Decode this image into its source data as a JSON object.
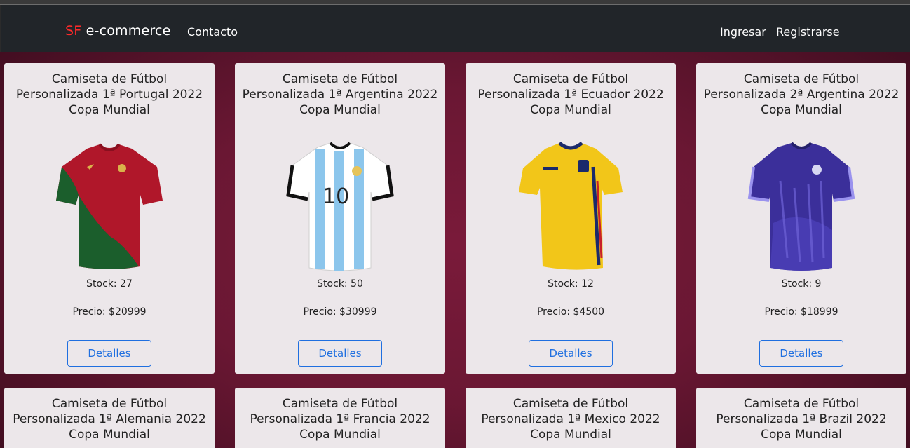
{
  "navbar": {
    "brand_prefix": "SF",
    "brand_suffix": " e-commerce",
    "contact": "Contacto",
    "login": "Ingresar",
    "register": "Registrarse"
  },
  "colors": {
    "brand_accent": "#ff2a2a",
    "button_blue": "#1f6fe0",
    "background": "#6a1733"
  },
  "products": [
    {
      "title_lines": [
        "Camiseta de Fútbol",
        "Personalizada 1ª Portugal 2022",
        "Copa Mundial"
      ],
      "stock": "Stock: 27",
      "price": "Precio: $20999",
      "button": "Detalles",
      "image": "portugal-jersey-icon"
    },
    {
      "title_lines": [
        "Camiseta de Fútbol",
        "Personalizada 1ª Argentina 2022",
        "Copa Mundial"
      ],
      "stock": "Stock: 50",
      "price": "Precio: $30999",
      "button": "Detalles",
      "image": "argentina-home-jersey-icon",
      "jersey_number": "10"
    },
    {
      "title_lines": [
        "Camiseta de Fútbol",
        "Personalizada 1ª Ecuador 2022",
        "Copa Mundial"
      ],
      "stock": "Stock: 12",
      "price": "Precio: $4500",
      "button": "Detalles",
      "image": "ecuador-jersey-icon"
    },
    {
      "title_lines": [
        "Camiseta de Fútbol",
        "Personalizada 2ª Argentina 2022",
        "Copa Mundial"
      ],
      "stock": "Stock: 9",
      "price": "Precio: $18999",
      "button": "Detalles",
      "image": "argentina-away-jersey-icon"
    },
    {
      "title_lines": [
        "Camiseta de Fútbol",
        "Personalizada 1ª Alemania 2022",
        "Copa Mundial"
      ]
    },
    {
      "title_lines": [
        "Camiseta de Fútbol",
        "Personalizada 1ª Francia 2022",
        "Copa Mundial"
      ]
    },
    {
      "title_lines": [
        "Camiseta de Fútbol",
        "Personalizada 1ª Mexico 2022",
        "Copa Mundial"
      ]
    },
    {
      "title_lines": [
        "Camiseta de Fútbol",
        "Personalizada 1ª Brazil 2022",
        "Copa Mundial"
      ]
    }
  ]
}
